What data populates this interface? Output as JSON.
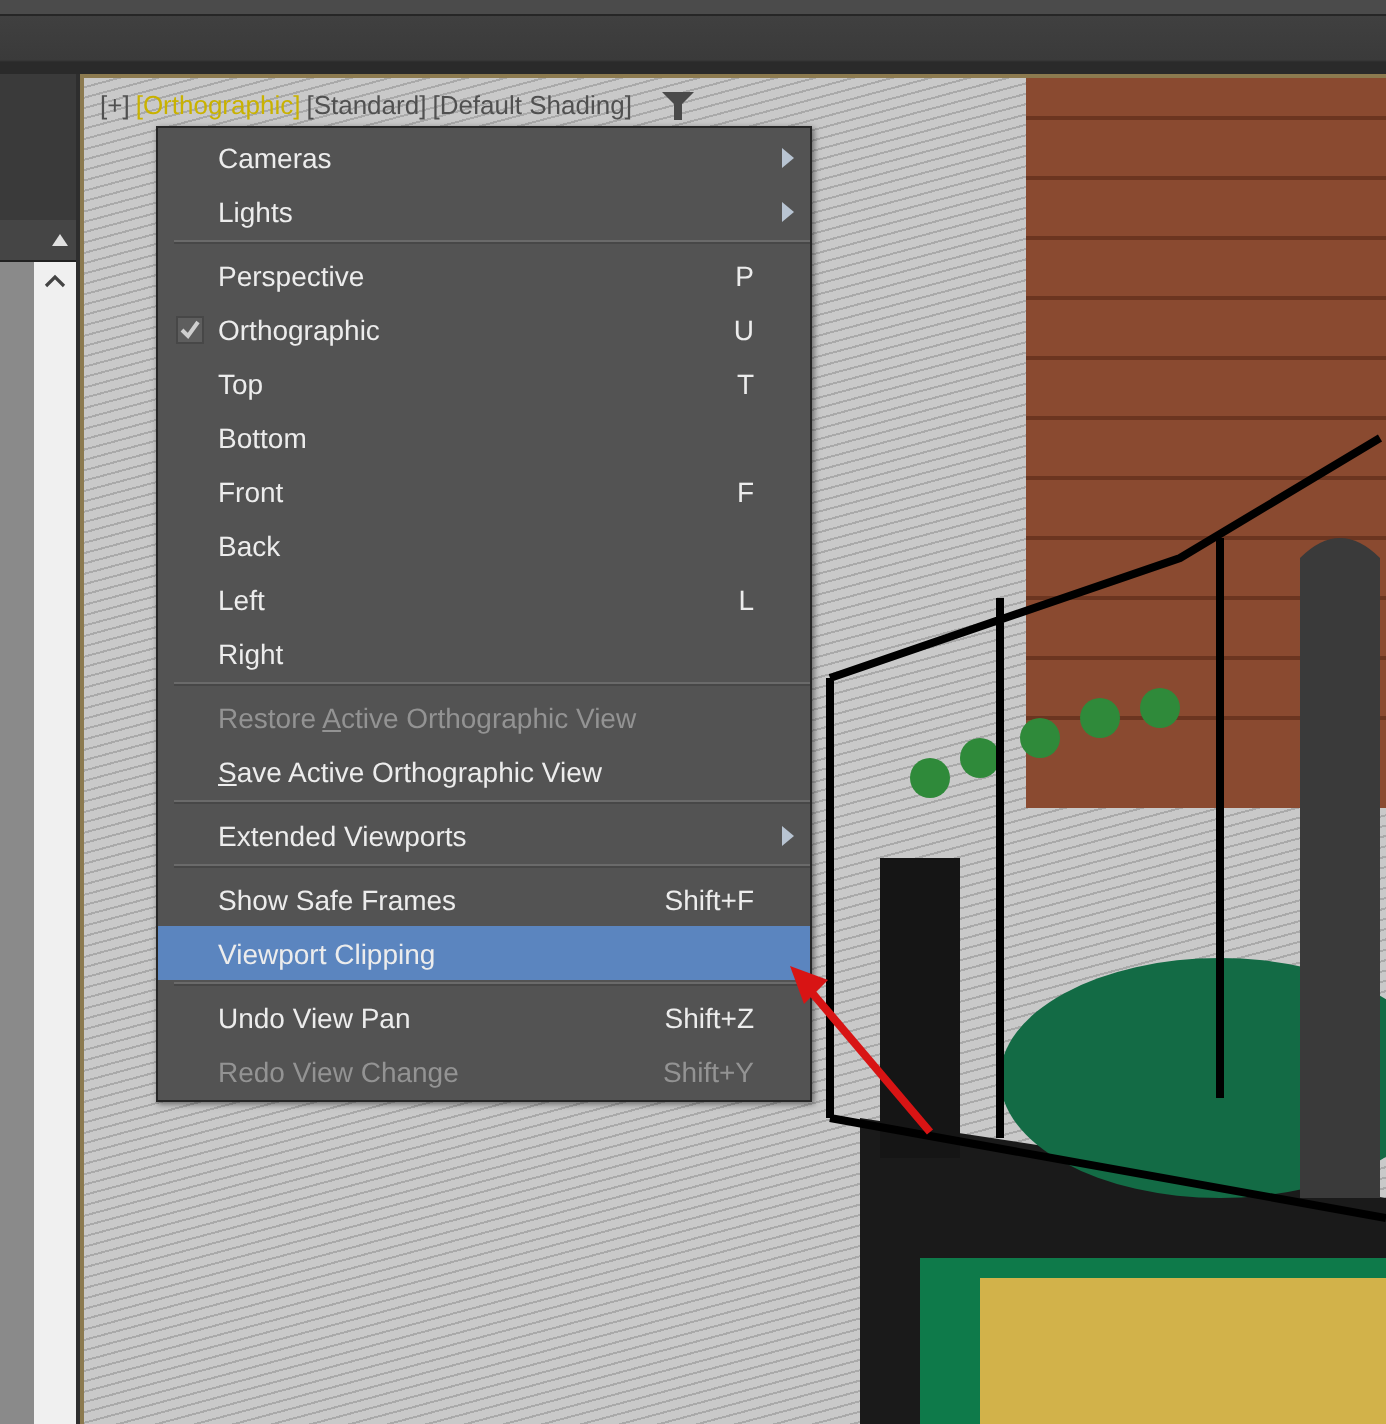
{
  "viewport_labels": [
    {
      "text": "[+]",
      "selected": false
    },
    {
      "text": "[Orthographic]",
      "selected": true
    },
    {
      "text": "[Standard]",
      "selected": false
    },
    {
      "text": "[Default Shading]",
      "selected": false
    }
  ],
  "context_menu": [
    {
      "kind": "item",
      "label": "Cameras",
      "checked": false,
      "disabled": false,
      "submenu": true,
      "selected": false
    },
    {
      "kind": "item",
      "label": "Lights",
      "checked": false,
      "disabled": false,
      "submenu": true,
      "selected": false
    },
    {
      "kind": "separator"
    },
    {
      "kind": "item",
      "label": "Perspective",
      "shortcut": "P",
      "checked": false,
      "disabled": false,
      "submenu": false,
      "selected": false
    },
    {
      "kind": "item",
      "label": "Orthographic",
      "shortcut": "U",
      "checked": true,
      "disabled": false,
      "submenu": false,
      "selected": false
    },
    {
      "kind": "item",
      "label": "Top",
      "shortcut": "T",
      "checked": false,
      "disabled": false,
      "submenu": false,
      "selected": false
    },
    {
      "kind": "item",
      "label": "Bottom",
      "checked": false,
      "disabled": false,
      "submenu": false,
      "selected": false
    },
    {
      "kind": "item",
      "label": "Front",
      "shortcut": "F",
      "checked": false,
      "disabled": false,
      "submenu": false,
      "selected": false
    },
    {
      "kind": "item",
      "label": "Back",
      "checked": false,
      "disabled": false,
      "submenu": false,
      "selected": false
    },
    {
      "kind": "item",
      "label": "Left",
      "shortcut": "L",
      "checked": false,
      "disabled": false,
      "submenu": false,
      "selected": false
    },
    {
      "kind": "item",
      "label": "Right",
      "checked": false,
      "disabled": false,
      "submenu": false,
      "selected": false
    },
    {
      "kind": "separator"
    },
    {
      "kind": "item",
      "label": "Restore ",
      "mnemonic": "A",
      "label_rest": "ctive Orthographic View",
      "checked": false,
      "disabled": true,
      "submenu": false,
      "selected": false
    },
    {
      "kind": "item",
      "mnemonic": "S",
      "label_rest": "ave Active Orthographic View",
      "checked": false,
      "disabled": false,
      "submenu": false,
      "selected": false
    },
    {
      "kind": "separator"
    },
    {
      "kind": "item",
      "label": "Extended Viewports",
      "checked": false,
      "disabled": false,
      "submenu": true,
      "selected": false
    },
    {
      "kind": "separator"
    },
    {
      "kind": "item",
      "label": "Show Safe Frames",
      "shortcut": "Shift+F",
      "checked": false,
      "disabled": false,
      "submenu": false,
      "selected": false
    },
    {
      "kind": "item",
      "label": "Viewport Clipping",
      "checked": false,
      "disabled": false,
      "submenu": false,
      "selected": true
    },
    {
      "kind": "separator"
    },
    {
      "kind": "item",
      "label": "Undo View Pan",
      "shortcut": "Shift+Z",
      "checked": false,
      "disabled": false,
      "submenu": false,
      "selected": false
    },
    {
      "kind": "item",
      "label": "Redo View Change",
      "shortcut": "Shift+Y",
      "checked": false,
      "disabled": true,
      "submenu": false,
      "selected": false
    }
  ]
}
